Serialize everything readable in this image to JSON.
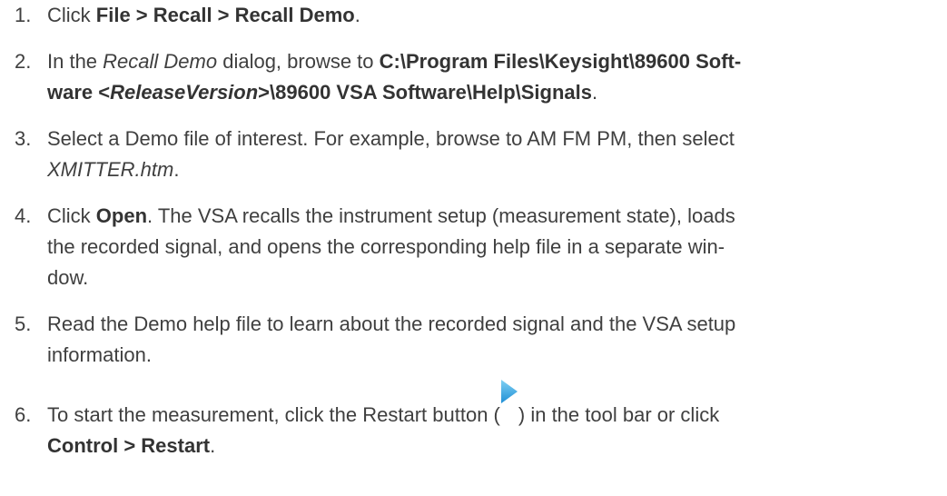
{
  "steps": [
    {
      "num": "1.",
      "lines": [
        [
          {
            "t": "Click "
          },
          {
            "t": "File > Recall > Recall Demo",
            "s": "b"
          },
          {
            "t": "."
          }
        ]
      ]
    },
    {
      "num": "2.",
      "lines": [
        [
          {
            "t": "In the "
          },
          {
            "t": "Recall Demo",
            "s": "i"
          },
          {
            "t": " dialog, browse to "
          },
          {
            "t": "C:\\Program Files\\Keysight\\89600 Soft-",
            "s": "b"
          }
        ],
        [
          {
            "t": "ware <",
            "s": "b"
          },
          {
            "t": "ReleaseVersion",
            "s": "bi"
          },
          {
            "t": ">\\89600 VSA Software\\Help\\Signals",
            "s": "b"
          },
          {
            "t": "."
          }
        ]
      ]
    },
    {
      "num": "3.",
      "lines": [
        [
          {
            "t": "Select a Demo file of interest. For example, browse to AM FM PM, then select"
          }
        ],
        [
          {
            "t": "XMITTER.htm",
            "s": "i"
          },
          {
            "t": "."
          }
        ]
      ]
    },
    {
      "num": "4.",
      "lines": [
        [
          {
            "t": "Click "
          },
          {
            "t": "Open",
            "s": "b"
          },
          {
            "t": ". The VSA recalls the instrument setup (measurement state), loads"
          }
        ],
        [
          {
            "t": "the recorded signal, and opens the corresponding help file in a separate win-"
          }
        ],
        [
          {
            "t": "dow."
          }
        ]
      ]
    },
    {
      "num": "5.",
      "lines": [
        [
          {
            "t": "Read the Demo help file to learn about the recorded signal and the VSA setup"
          }
        ],
        [
          {
            "t": "information."
          }
        ]
      ]
    },
    {
      "num": "6.",
      "lines": [
        [
          {
            "t": "To start the measurement, click the Restart button ("
          },
          {
            "icon": "restart-play-icon"
          },
          {
            "t": ") in the tool bar or click"
          }
        ],
        [
          {
            "t": "Control > Restart",
            "s": "b"
          },
          {
            "t": "."
          }
        ]
      ]
    }
  ],
  "colors": {
    "text": "#3f3f3f",
    "bold": "#333333",
    "icon_light": "#7fd0f3",
    "icon_dark": "#1f8fd6"
  }
}
